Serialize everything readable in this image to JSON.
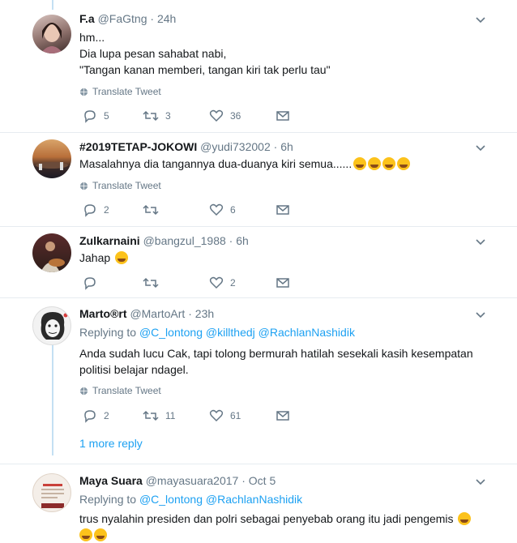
{
  "more_replies": "1 more reply",
  "translate_label": "Translate Tweet",
  "tweets": [
    {
      "name": "F.a",
      "handle": "@FaGtng",
      "time": "24h",
      "lines": [
        "hm...",
        "Dia lupa pesan sahabat nabi,",
        "\"Tangan kanan memberi, tangan kiri tak perlu tau\""
      ],
      "replies": "5",
      "retweets": "3",
      "likes": "36"
    },
    {
      "name": "#2019TETAP-JOKOWI",
      "handle": "@yudi732002",
      "time": "6h",
      "lines": [
        "Masalahnya dia tangannya dua-duanya kiri semua......"
      ],
      "replies": "2",
      "retweets": "",
      "likes": "6"
    },
    {
      "name": "Zulkarnaini",
      "handle": "@bangzul_1988",
      "time": "6h",
      "lines": [
        "Jahap"
      ],
      "replies": "",
      "retweets": "",
      "likes": "2"
    },
    {
      "name": "Marto®rt",
      "handle": "@MartoArt",
      "time": "23h",
      "replying_label": "Replying to",
      "replying_to": [
        "@C_lontong",
        "@killthedj",
        "@RachlanNashidik"
      ],
      "lines": [
        "Anda sudah lucu Cak, tapi tolong bermurah hatilah sesekali kasih kesempatan",
        "politisi belajar ndagel."
      ],
      "replies": "2",
      "retweets": "11",
      "likes": "61"
    },
    {
      "name": "Maya Suara",
      "handle": "@mayasuara2017",
      "time": "Oct 5",
      "replying_label": "Replying to",
      "replying_to": [
        "@C_lontong",
        "@RachlanNashidik"
      ],
      "lines": [
        "trus nyalahin presiden dan polri sebagai penyebab orang itu jadi pengemis"
      ]
    }
  ]
}
